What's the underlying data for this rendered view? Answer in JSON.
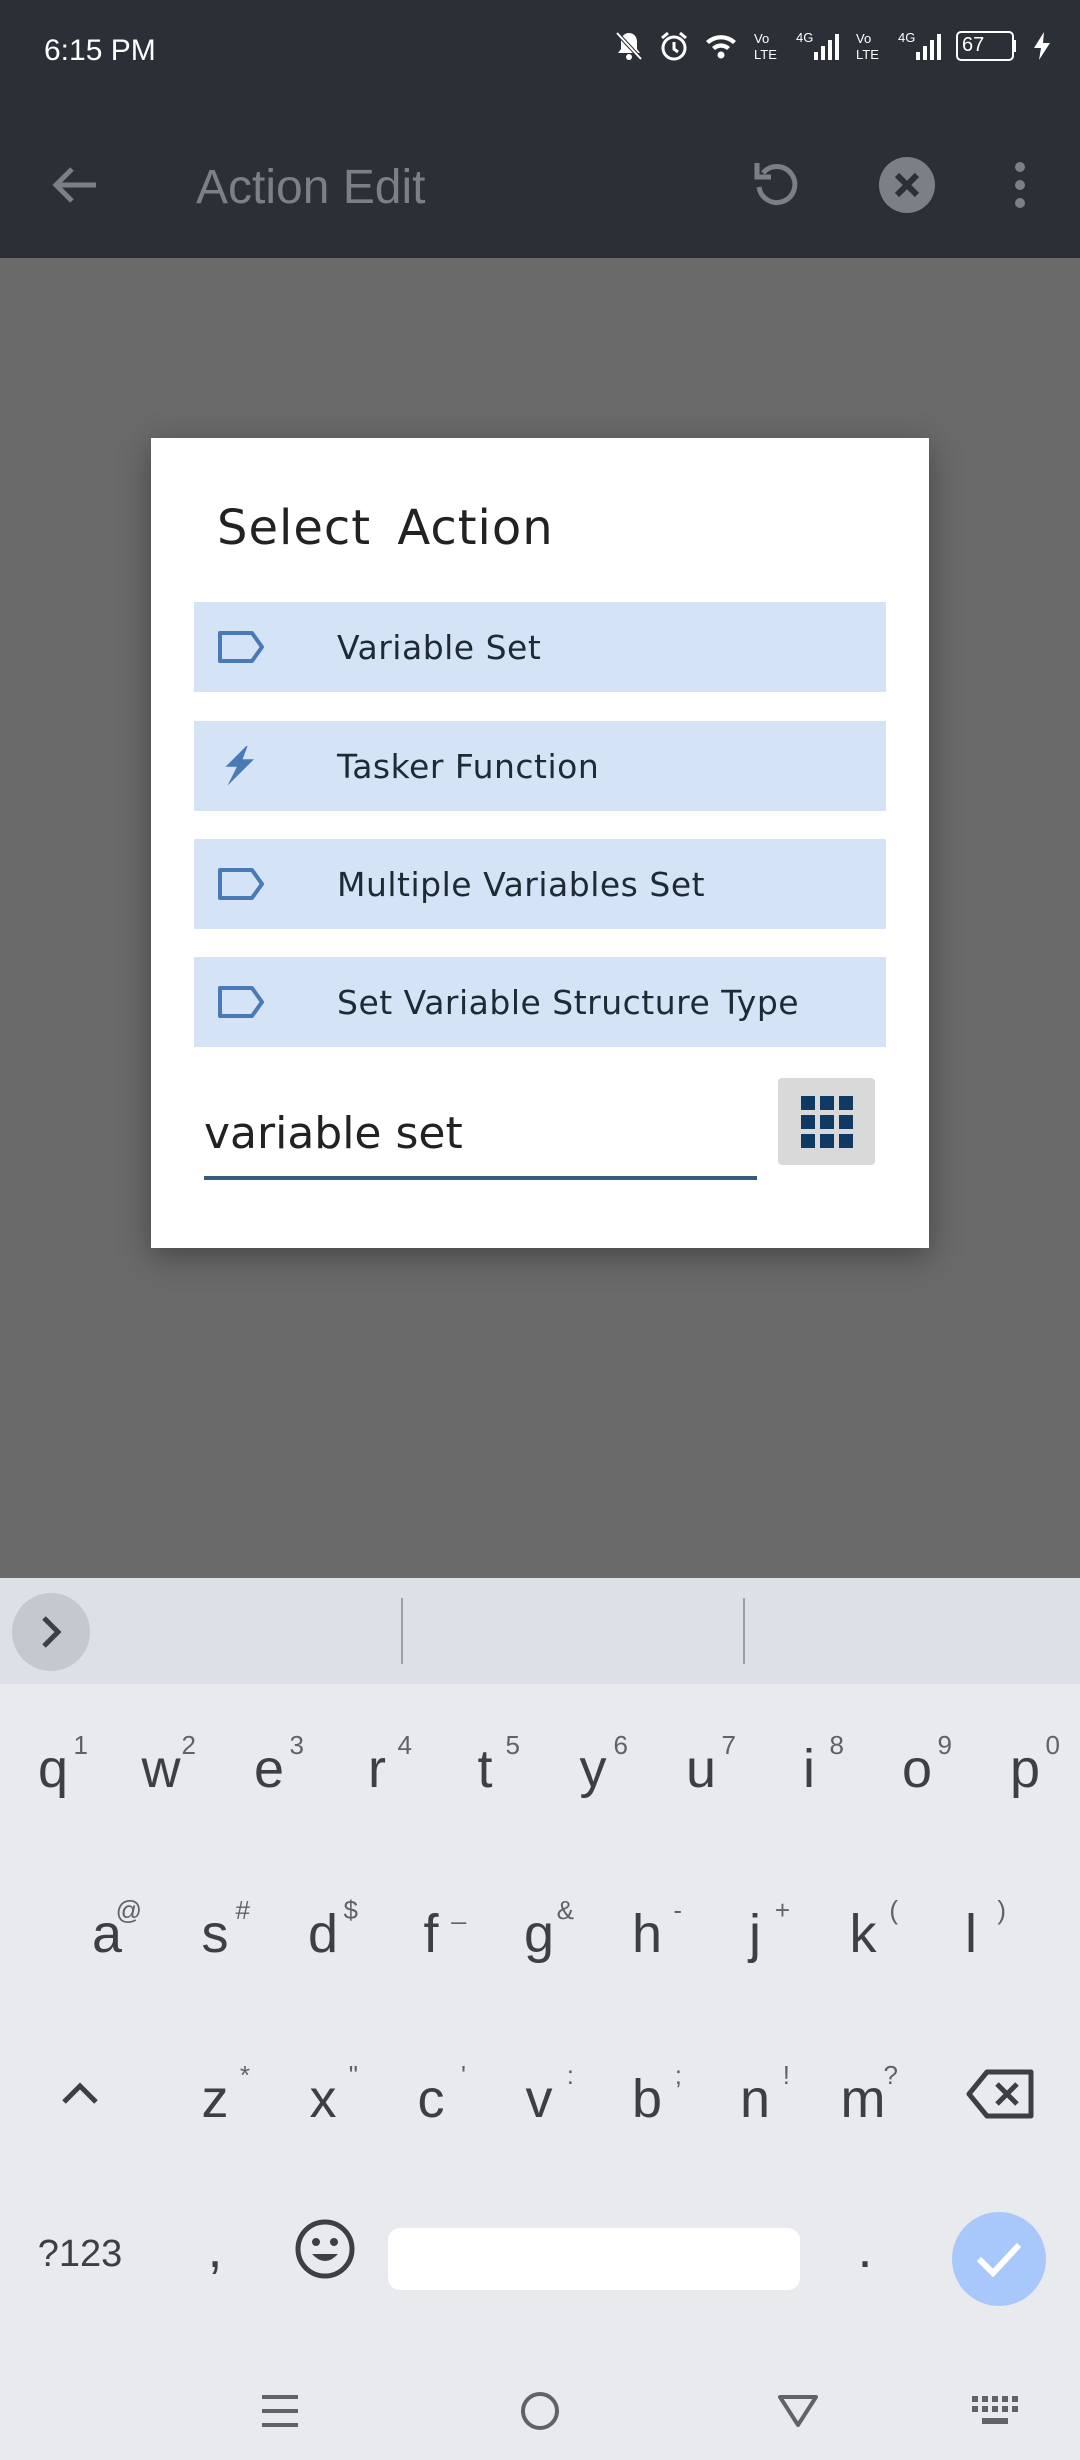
{
  "status_bar": {
    "time": "6:15 PM",
    "battery": "67"
  },
  "toolbar": {
    "title": "Action Edit"
  },
  "dialog": {
    "title": "Select Action",
    "items": [
      {
        "label": "Variable Set",
        "icon": "tag-icon"
      },
      {
        "label": "Tasker Function",
        "icon": "lightning-icon"
      },
      {
        "label": "Multiple Variables Set",
        "icon": "tag-icon"
      },
      {
        "label": "Set Variable Structure Type",
        "icon": "tag-icon"
      }
    ],
    "search": {
      "value": "variable set"
    }
  },
  "keyboard": {
    "row1": [
      {
        "k": "q",
        "h": "1"
      },
      {
        "k": "w",
        "h": "2"
      },
      {
        "k": "e",
        "h": "3"
      },
      {
        "k": "r",
        "h": "4"
      },
      {
        "k": "t",
        "h": "5"
      },
      {
        "k": "y",
        "h": "6"
      },
      {
        "k": "u",
        "h": "7"
      },
      {
        "k": "i",
        "h": "8"
      },
      {
        "k": "o",
        "h": "9"
      },
      {
        "k": "p",
        "h": "0"
      }
    ],
    "row2": [
      {
        "k": "a",
        "h": "@"
      },
      {
        "k": "s",
        "h": "#"
      },
      {
        "k": "d",
        "h": "$"
      },
      {
        "k": "f",
        "h": "_"
      },
      {
        "k": "g",
        "h": "&"
      },
      {
        "k": "h",
        "h": "-"
      },
      {
        "k": "j",
        "h": "+"
      },
      {
        "k": "k",
        "h": "("
      },
      {
        "k": "l",
        "h": ")"
      }
    ],
    "row3": [
      {
        "k": "z",
        "h": "*"
      },
      {
        "k": "x",
        "h": "\""
      },
      {
        "k": "c",
        "h": "'"
      },
      {
        "k": "v",
        "h": ":"
      },
      {
        "k": "b",
        "h": ";"
      },
      {
        "k": "n",
        "h": "!"
      },
      {
        "k": "m",
        "h": "?"
      }
    ],
    "symbols_label": "?123",
    "comma": ",",
    "period": "."
  }
}
